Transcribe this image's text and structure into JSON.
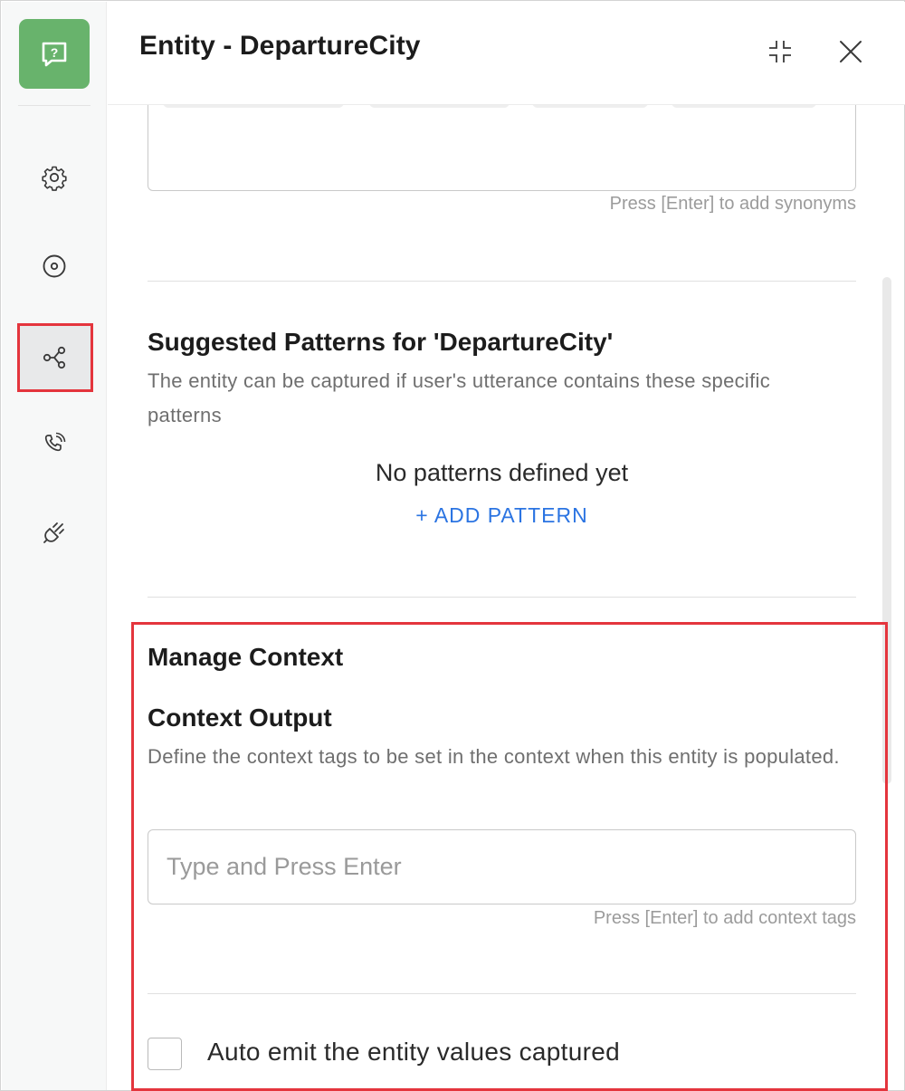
{
  "header": {
    "title": "Entity - DepartureCity",
    "collapse_icon": "collapse-arrows-icon",
    "close_icon": "close-icon"
  },
  "sidebar": {
    "logo_icon": "help-chat-icon",
    "items": [
      {
        "name": "settings",
        "icon": "gear-icon",
        "active": false
      },
      {
        "name": "target",
        "icon": "target-circle-icon",
        "active": false
      },
      {
        "name": "nodes",
        "icon": "connection-nodes-icon",
        "active": true
      },
      {
        "name": "voice",
        "icon": "phone-call-icon",
        "active": false
      },
      {
        "name": "integrations",
        "icon": "plug-icon",
        "active": false
      }
    ]
  },
  "synonyms": {
    "hint": "Press [Enter] to add synonyms"
  },
  "patterns": {
    "title": "Suggested Patterns for 'DepartureCity'",
    "description": "The entity can be captured if user's utterance contains these specific patterns",
    "empty_text": "No patterns defined yet",
    "add_label": "+ ADD PATTERN"
  },
  "context": {
    "title": "Manage Context",
    "output_title": "Context Output",
    "output_description": "Define the context tags to be set in the context when this entity is populated.",
    "input_placeholder": "Type and Press Enter",
    "input_value": "",
    "hint": "Press [Enter] to add context tags",
    "auto_emit_label": "Auto emit the entity values captured",
    "auto_emit_checked": false
  },
  "colors": {
    "accent": "#2b74e2",
    "logo_bg": "#68b36c",
    "highlight": "#e4353d"
  }
}
